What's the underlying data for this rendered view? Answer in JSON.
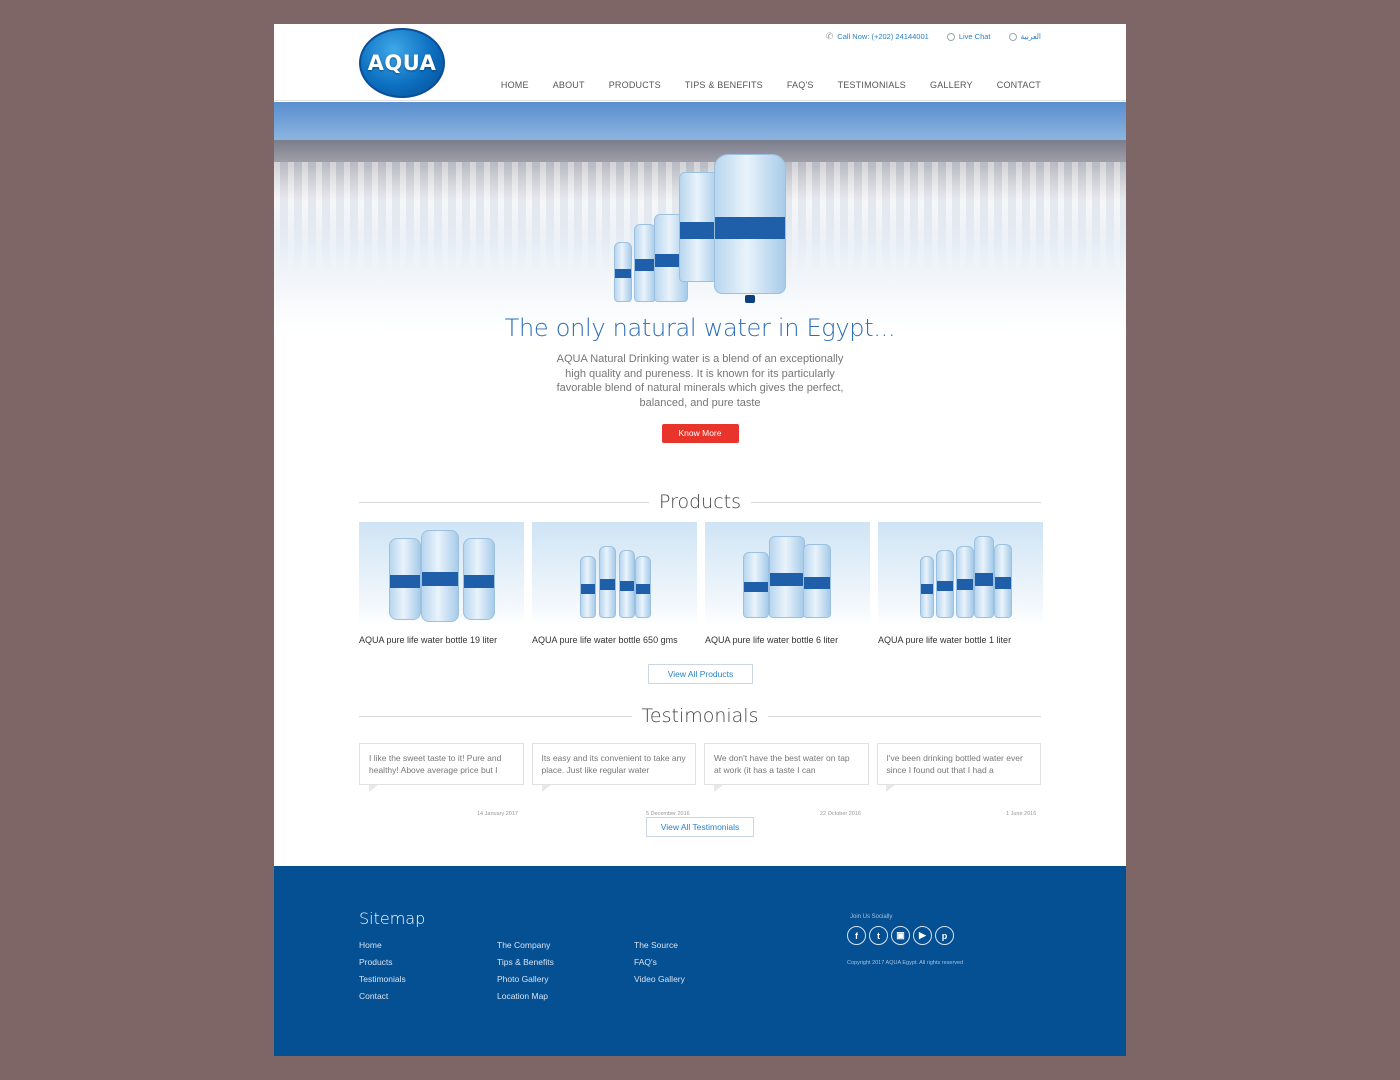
{
  "header": {
    "logo_text": "AQUA",
    "call": "Call Now: (+202) 24144001",
    "live_chat": "Live Chat",
    "language": "العربية",
    "nav": [
      "HOME",
      "ABOUT",
      "PRODUCTS",
      "TIPS & BENEFITS",
      "FAQ'S",
      "TESTIMONIALS",
      "GALLERY",
      "CONTACT"
    ]
  },
  "hero": {
    "title": "The only natural water in Egypt...",
    "description": "AQUA Natural Drinking water is a blend of an exceptionally high quality and pureness. It is known for its particularly favorable blend of natural minerals which gives the perfect, balanced, and pure taste",
    "button": "Know More"
  },
  "products": {
    "heading": "Products",
    "items": [
      {
        "name": "AQUA pure life water bottle 19 liter"
      },
      {
        "name": "AQUA pure life water bottle 650 gms"
      },
      {
        "name": "AQUA pure life water bottle 6 liter"
      },
      {
        "name": "AQUA pure life water bottle 1 liter"
      }
    ],
    "view_all": "View All Products"
  },
  "testimonials": {
    "heading": "Testimonials",
    "items": [
      {
        "text": "I like the sweet taste to it! Pure and healthy! Above average price but I",
        "date": "14 January 2017"
      },
      {
        "text": "Its easy and its convenient to take any place. Just like regular water",
        "date": "5 December 2016"
      },
      {
        "text": "We don't have the best water on tap at work (it has a taste I can",
        "date": "22 October 2016"
      },
      {
        "text": "I've been drinking bottled water ever since I found out that I had a",
        "date": "1 June 2016"
      }
    ],
    "view_all": "View All Testimonials"
  },
  "footer": {
    "sitemap_title": "Sitemap",
    "col1": [
      "Home",
      "Products",
      "Testimonials",
      "Contact"
    ],
    "col2": [
      "The Company",
      "Tips & Benefits",
      "Photo Gallery",
      "Location Map"
    ],
    "col3": [
      "The Source",
      "FAQ's",
      "Video Gallery"
    ],
    "social_label": "Join Us Socially",
    "social_icons": [
      "facebook-icon",
      "twitter-icon",
      "instagram-icon",
      "youtube-icon",
      "pinterest-icon"
    ],
    "copyright": "Copyright 2017 AQUA Egypt. All rights reserved"
  },
  "colors": {
    "brand_blue": "#054f93",
    "accent_red": "#e8342a",
    "link_blue": "#2a82c7",
    "background": "#7f6666"
  }
}
